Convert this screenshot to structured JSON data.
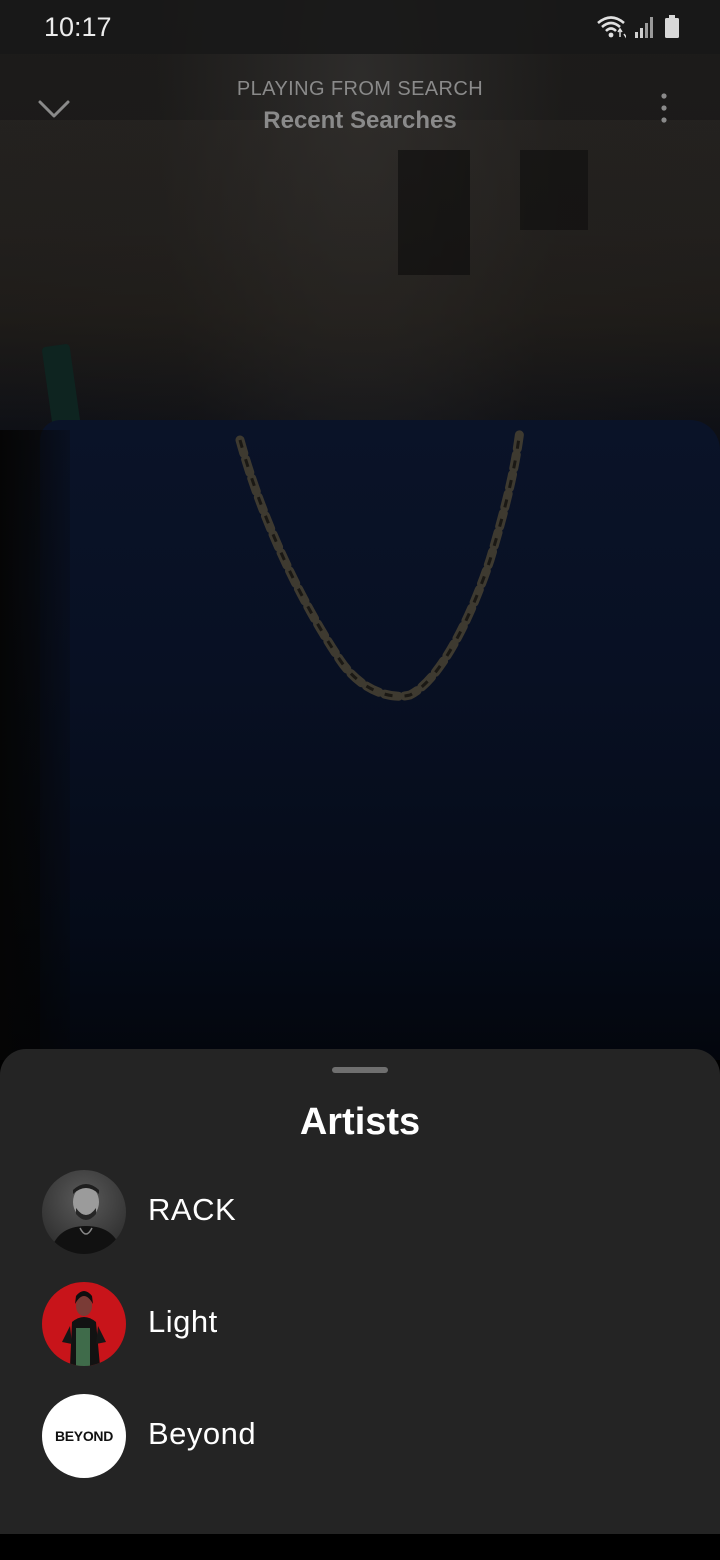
{
  "status_bar": {
    "time": "10:17",
    "icons": [
      "wifi-icon",
      "signal-icon",
      "battery-icon"
    ]
  },
  "player_header": {
    "collapse_icon": "chevron-down-icon",
    "context_type": "PLAYING FROM SEARCH",
    "context_name": "Recent Searches",
    "more_icon": "more-vertical-icon"
  },
  "sheet": {
    "title": "Artists",
    "artists": [
      {
        "name": "RACK"
      },
      {
        "name": "Light"
      },
      {
        "name": "Beyond",
        "avatar_text": "BEYOND"
      }
    ]
  },
  "colors": {
    "sheet_background": "#242424",
    "status_bar": "#181818",
    "header_text": "#8a8a8a",
    "text_primary": "#ffffff",
    "light_avatar_red": "#c8141a"
  }
}
